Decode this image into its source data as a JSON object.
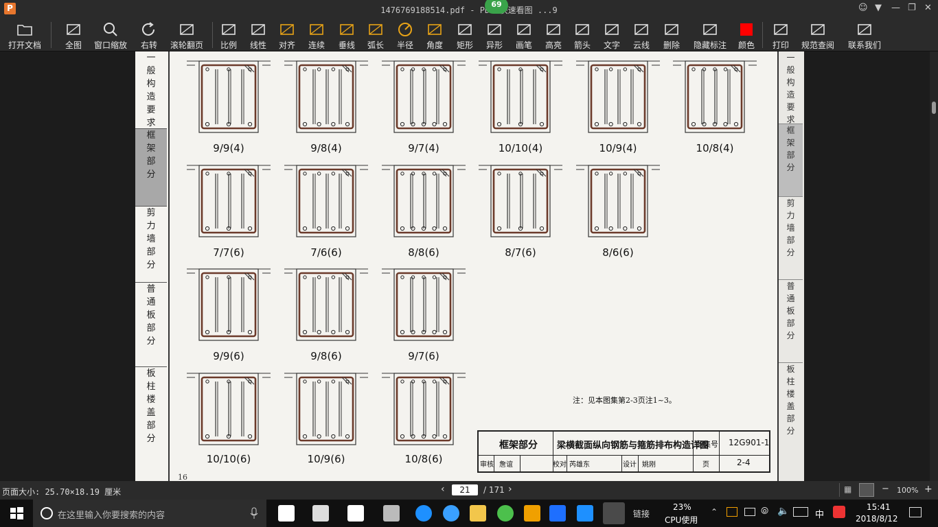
{
  "titlebar": {
    "app_logo": "P",
    "title": "1476769188514.pdf - PDF 快速看图 ...9",
    "badge": "69"
  },
  "toolbar": {
    "items": [
      {
        "label": "打开文档",
        "icon": "folder-icon"
      },
      {
        "label": "全图",
        "icon": "fit-all-icon"
      },
      {
        "label": "窗口缩放",
        "icon": "zoom-window-icon"
      },
      {
        "label": "右转",
        "icon": "rotate-right-icon"
      },
      {
        "label": "滚轮翻页",
        "icon": "mouse-wheel-icon"
      },
      {
        "label": "比例",
        "icon": "scale-ruler-icon"
      },
      {
        "label": "线性",
        "icon": "linear-measure-icon"
      },
      {
        "label": "对齐",
        "icon": "aligned-measure-icon"
      },
      {
        "label": "连续",
        "icon": "continuous-measure-icon"
      },
      {
        "label": "垂线",
        "icon": "perpendicular-icon"
      },
      {
        "label": "弧长",
        "icon": "arc-length-icon"
      },
      {
        "label": "半径",
        "icon": "radius-icon"
      },
      {
        "label": "角度",
        "icon": "angle-icon"
      },
      {
        "label": "矩形",
        "icon": "rectangle-area-icon"
      },
      {
        "label": "异形",
        "icon": "polygon-area-icon"
      },
      {
        "label": "画笔",
        "icon": "pen-icon"
      },
      {
        "label": "高亮",
        "icon": "highlighter-icon"
      },
      {
        "label": "箭头",
        "icon": "arrow-icon"
      },
      {
        "label": "文字",
        "icon": "text-icon"
      },
      {
        "label": "云线",
        "icon": "cloud-line-icon"
      },
      {
        "label": "删除",
        "icon": "eraser-icon"
      },
      {
        "label": "隐藏标注",
        "icon": "hide-annotation-icon"
      },
      {
        "label": "颜色",
        "icon": "color-swatch-icon"
      },
      {
        "label": "打印",
        "icon": "printer-icon"
      },
      {
        "label": "规范查阅",
        "icon": "book-search-icon"
      },
      {
        "label": "联系我们",
        "icon": "contact-icon"
      }
    ],
    "accent": "#e8a317",
    "swatch_color": "#ff0000"
  },
  "document": {
    "left_tabs": [
      "一般构造要求",
      "框架部分",
      "剪力墙部分",
      "普通板部分",
      "板柱楼盖部分"
    ],
    "right_tabs": [
      "一般构造要求",
      "框架部分",
      "剪力墙部分",
      "普通板部分",
      "板柱楼盖部分"
    ],
    "row1": [
      "9/9(4)",
      "9/8(4)",
      "9/7(4)",
      "10/10(4)",
      "10/9(4)",
      "10/8(4)"
    ],
    "row2": [
      "7/7(6)",
      "7/6(6)",
      "8/8(6)",
      "8/7(6)",
      "8/6(6)"
    ],
    "row3": [
      "9/9(6)",
      "9/8(6)",
      "9/7(6)"
    ],
    "row4": [
      "10/10(6)",
      "10/9(6)",
      "10/8(6)"
    ],
    "note": "注：见本图集第2-3页注1~3。",
    "title_block": {
      "section": "框架部分",
      "title": "梁横截面纵向钢筋与箍筋排布构造详图",
      "atlas_label": "图集号",
      "atlas_no": "12G901-1",
      "page_label": "页",
      "page_no": "2-4",
      "review": "审核",
      "reviewer": "詹谊",
      "check": "校对",
      "checker": "芮雄东",
      "design": "设计",
      "designer": "姚刚"
    },
    "page_number": "16"
  },
  "statusbar": {
    "page_size": "页面大小: 25.70×18.19 厘米",
    "current_page": "21",
    "total_pages": "/ 171",
    "zoom": "100%"
  },
  "taskbar": {
    "search_placeholder": "在这里输入你要搜索的内容",
    "cpu_percent": "23%",
    "cpu_label": "CPU使用",
    "link_label": "链接",
    "time": "15:41",
    "date": "2018/8/12",
    "ime": "中"
  }
}
